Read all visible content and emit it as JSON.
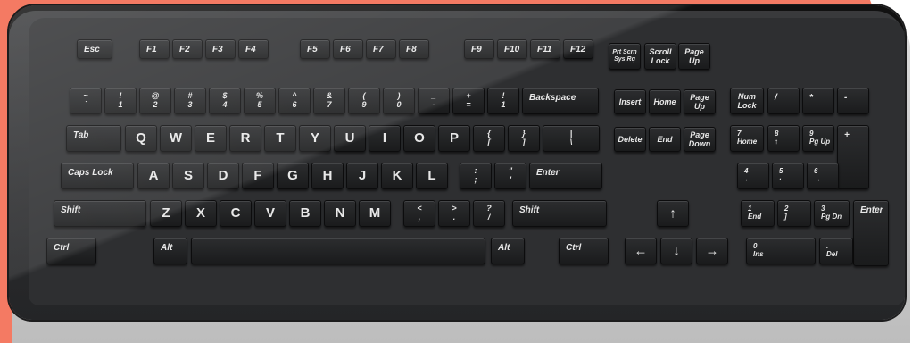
{
  "background_color": "#f47a63",
  "keyboard_color": "#2e2f31",
  "keys": {
    "esc": "Esc",
    "f1": "F1",
    "f2": "F2",
    "f3": "F3",
    "f4": "F4",
    "f5": "F5",
    "f6": "F6",
    "f7": "F7",
    "f8": "F8",
    "f9": "F9",
    "f10": "F10",
    "f11": "F11",
    "f12": "F12",
    "prtscn": "Prt Scrn\nSys Rq",
    "scroll": "Scroll\nLock",
    "pageup_top": "Page\nUp",
    "tilde": "~\n`",
    "k1": "!\n1",
    "k2": "@\n2",
    "k3": "#\n3",
    "k4": "$\n4",
    "k5": "%\n5",
    "k6": "^\n6",
    "k7": "&\n7",
    "k8": "(\n9",
    "k9": ")\n0",
    "kminus": "_\n-",
    "kplus": "+\n=",
    "kbang": "!\n1",
    "backspace": "Backspace",
    "insert": "Insert",
    "home": "Home",
    "pageup": "Page\nUp",
    "numlock": "Num\nLock",
    "kslash": "/",
    "kstar": "*",
    "kminus_np": "-",
    "tab": "Tab",
    "q": "Q",
    "w": "W",
    "e": "E",
    "r": "R",
    "t": "T",
    "y": "Y",
    "u": "U",
    "i": "I",
    "o": "O",
    "p": "P",
    "lbrace": "{\n[",
    "rbrace": "}\n]",
    "pipe": "|\n\\",
    "delete": "Delete",
    "end": "End",
    "pagedown": "Page\nDown",
    "np7": "7\nHome",
    "np8": "8\n↑",
    "np9": "9\nPg Up",
    "npplus": "+",
    "caps": "Caps Lock",
    "a": "A",
    "s": "S",
    "d": "D",
    "f": "F",
    "g": "G",
    "h": "H",
    "j": "J",
    "k": "K",
    "l": "L",
    "colon": ":\n;",
    "quote": "\"\n'",
    "enter": "Enter",
    "np4": "4\n←",
    "np5": "5\n·",
    "np6": "6\n→",
    "shift_l": "Shift",
    "z": "Z",
    "x": "X",
    "c": "C",
    "v": "V",
    "b": "B",
    "n": "N",
    "m": "M",
    "lt": "<\n,",
    "gt": ">\n.",
    "qm": "?\n/",
    "shift_r": "Shift",
    "up": "↑",
    "np1": "1\nEnd",
    "np2": "2\n]",
    "np3": "3\nPg Dn",
    "npenter": "Enter",
    "ctrl_l": "Ctrl",
    "alt_l": "Alt",
    "space": "",
    "alt_r": "Alt",
    "ctrl_r": "Ctrl",
    "left": "←",
    "down": "↓",
    "right": "→",
    "np0": "0\nIns",
    "npdel": ".\nDel"
  }
}
